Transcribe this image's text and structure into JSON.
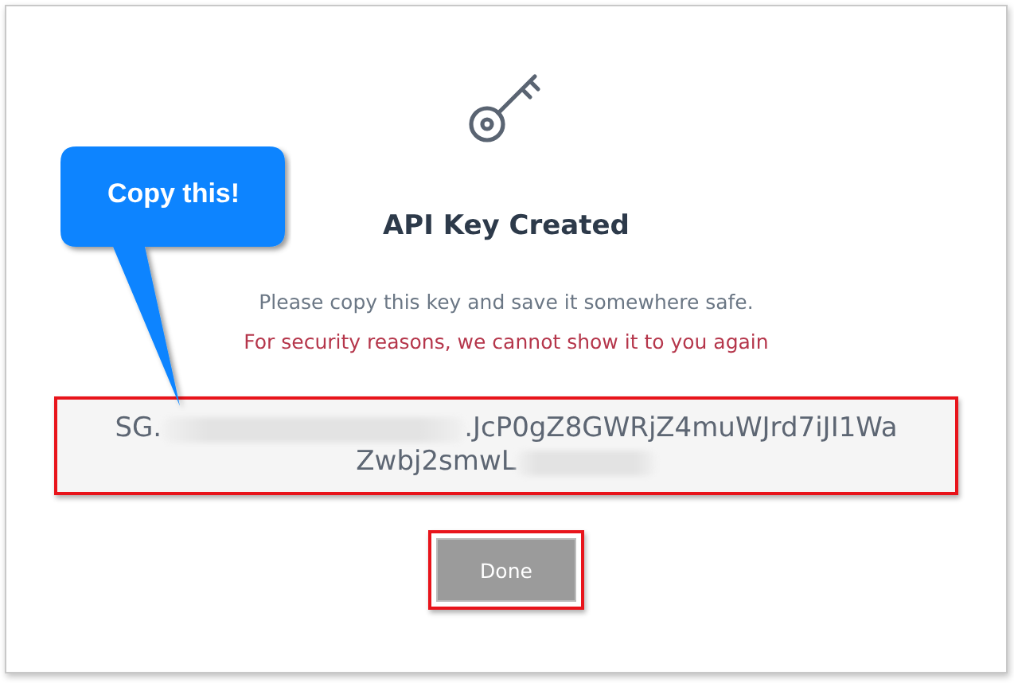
{
  "dialog": {
    "title": "API Key Created",
    "message": "Please copy this key and save it somewhere safe.",
    "warning": "For security reasons, we cannot show it to you again"
  },
  "api_key": {
    "highlighted": true,
    "lines": [
      [
        {
          "kind": "text",
          "text": "SG."
        },
        {
          "kind": "redacted"
        },
        {
          "kind": "text",
          "text": ".JcP0gZ8GWRjZ4muWJrd7iJI1Wa"
        }
      ],
      [
        {
          "kind": "text",
          "text": "Zwbj2smwL"
        },
        {
          "kind": "redacted"
        }
      ]
    ]
  },
  "done_button": {
    "label": "Done",
    "highlighted": true
  },
  "callout": {
    "text": "Copy this!"
  }
}
